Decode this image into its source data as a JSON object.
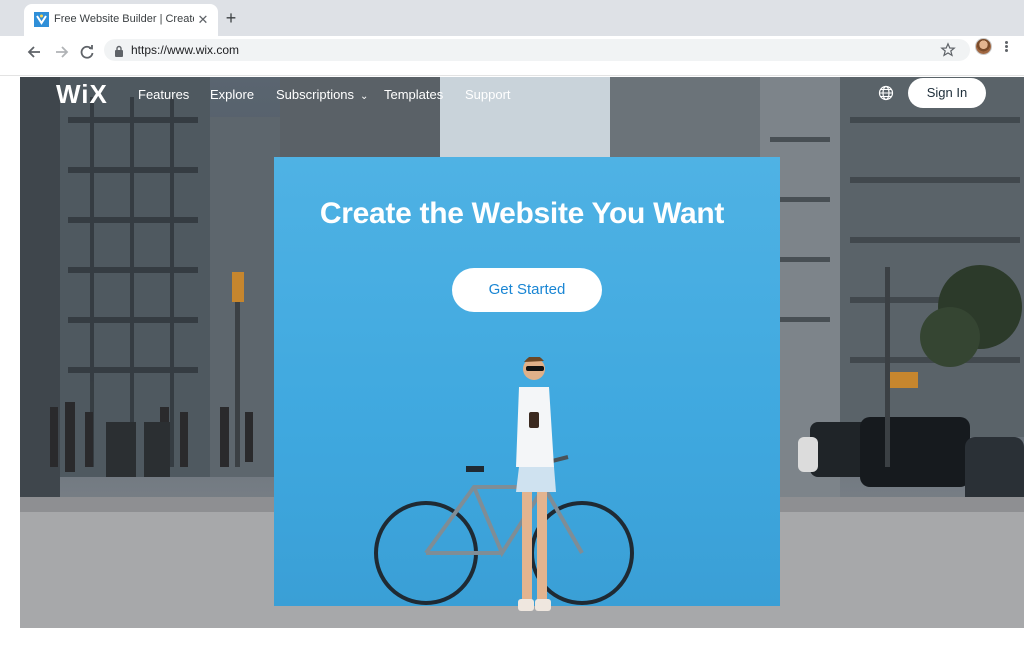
{
  "browser": {
    "tab_title": "Free Website Builder | Create a Free Website",
    "tab_close_icon": "close-icon",
    "new_tab_label": "+",
    "url": "https://www.wix.com",
    "icons": [
      "back-arrow-icon",
      "forward-arrow-icon",
      "reload-icon",
      "lock-icon",
      "star-icon",
      "profile-avatar",
      "menu-kebab-icon"
    ]
  },
  "site": {
    "logo": "WiX",
    "nav": {
      "features": "Features",
      "explore": "Explore",
      "subscriptions": "Subscriptions",
      "templates": "Templates",
      "support": "Support"
    },
    "sign_in": "Sign In",
    "hero": {
      "title": "Create the Website You Want",
      "cta": "Get Started"
    }
  },
  "colors": {
    "hero_blue": "#45ade2",
    "cta_text": "#1a86d4",
    "tab_strip": "#dee1e6"
  }
}
